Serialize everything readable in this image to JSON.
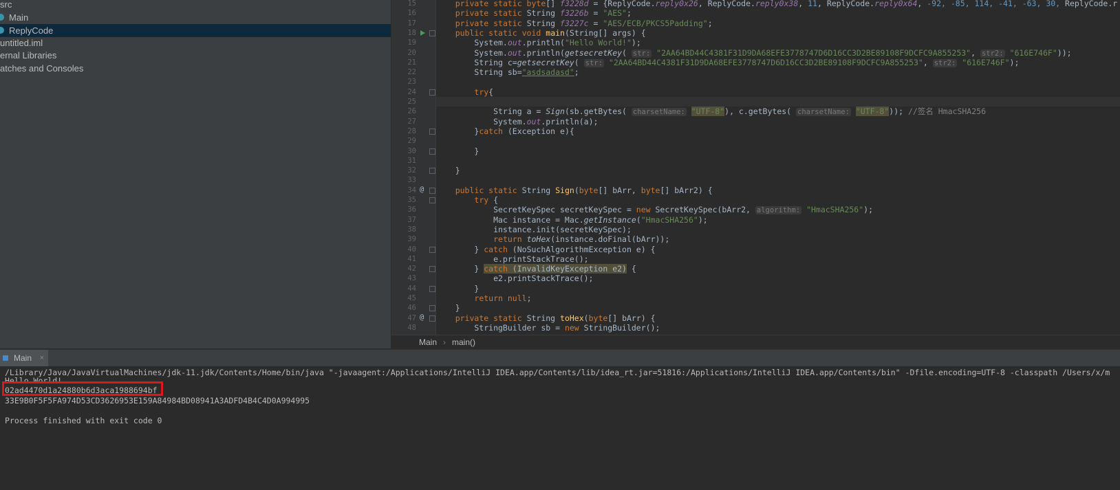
{
  "project_tree": [
    {
      "label": "src",
      "indent": 0,
      "icon": "folder-icon",
      "selected": false
    },
    {
      "label": "Main",
      "indent": 1,
      "icon": "class-icon",
      "selected": false
    },
    {
      "label": "ReplyCode",
      "indent": 1,
      "icon": "class-icon",
      "selected": true
    },
    {
      "label": "untitled.iml",
      "indent": 0,
      "icon": "iml-icon",
      "selected": false
    },
    {
      "label": "ernal Libraries",
      "indent": 0,
      "icon": "library-icon",
      "selected": false
    },
    {
      "label": "atches and Consoles",
      "indent": 0,
      "icon": "scratch-icon",
      "selected": false
    }
  ],
  "line_numbers": [
    "15",
    "16",
    "17",
    "18",
    "19",
    "20",
    "21",
    "22",
    "23",
    "24",
    "25",
    "26",
    "27",
    "28",
    "29",
    "30",
    "31",
    "32",
    "33",
    "34",
    "35",
    "36",
    "37",
    "38",
    "39",
    "40",
    "41",
    "42",
    "43",
    "44",
    "45",
    "46",
    "47",
    "48"
  ],
  "gutter_markers": {
    "run_line": "18",
    "override_lines": [
      "34",
      "47"
    ],
    "override_glyph": "@"
  },
  "code": {
    "l15": {
      "a": "    ",
      "kw": "private static byte",
      "b": "[] ",
      "fld": "f3228d",
      "c": " = {ReplyCode.",
      "r1": "reply0x26",
      "d": ", ReplyCode.",
      "r2": "reply0x38",
      "e": ", ",
      "n1": "11",
      "f": ", ReplyCode.",
      "r3": "reply0x64",
      "g": ", ",
      "n2": "-92, -85, 114, -41, -63, 30,",
      "h": " ReplyCode.r"
    },
    "l16": {
      "a": "    ",
      "kw": "private static ",
      "t": "String ",
      "fld": "f3226b",
      "c": " = ",
      "s": "\"AES\"",
      "d": ";"
    },
    "l17": {
      "a": "    ",
      "kw": "private static ",
      "t": "String ",
      "fld": "f3227c",
      "c": " = ",
      "s": "\"AES/ECB/PKCS5Padding\"",
      "d": ";"
    },
    "l18": {
      "a": "    ",
      "kw": "public static void ",
      "fn": "main",
      "b": "(String[] args) {"
    },
    "l19": {
      "a": "        System.",
      "o": "out",
      "b": ".println(",
      "s": "\"Hello World!\"",
      "c": ");"
    },
    "l20": {
      "a": "        System.",
      "o": "out",
      "b": ".println(",
      "m": "getsecretKey",
      "c": "( ",
      "h1": "str:",
      "s1": "\"2AA64BD44C4381F31D9DA68EFE3778747D6D16CC3D2BE89108F9DCFC9A855253\"",
      "d": ", ",
      "h2": "str2:",
      "s2": "\"616E746F\"",
      "e": "));"
    },
    "l21": {
      "a": "        String c=",
      "m": "getsecretKey",
      "c": "( ",
      "h1": "str:",
      "s1": "\"2AA64BD44C4381F31D9DA68EFE3778747D6D16CC3D2BE89108F9DCFC9A855253\"",
      "d": ", ",
      "h2": "str2:",
      "s2": "\"616E746F\"",
      "e": ");"
    },
    "l22": {
      "a": "        String sb=",
      "s": "\"asdsadasd\"",
      "b": ";"
    },
    "l24": {
      "a": "        ",
      "kw": "try",
      "b": "{"
    },
    "l26": {
      "a": "            String a = ",
      "m": "Sign",
      "b": "(sb.getBytes( ",
      "h1": "charsetName:",
      "s1": "\"UTF-8\"",
      "c": "), c.getBytes( ",
      "h2": "charsetName:",
      "s2": "\"UTF-8\"",
      "d": ")); ",
      "cm": "//签名 HmacSHA256"
    },
    "l27": {
      "a": "            System.",
      "o": "out",
      "b": ".println(a);"
    },
    "l28": {
      "a": "        }",
      "kw": "catch",
      "b": " (Exception e){"
    },
    "l30": {
      "a": "        }"
    },
    "l32": {
      "a": "    }"
    },
    "l34": {
      "a": "    ",
      "kw": "public static ",
      "t": "String ",
      "fn": "Sign",
      "b": "(",
      "k2": "byte",
      "c": "[] bArr, ",
      "k3": "byte",
      "d": "[] bArr2) {"
    },
    "l35": {
      "a": "        ",
      "kw": "try",
      "b": " {"
    },
    "l36": {
      "a": "            SecretKeySpec secretKeySpec = ",
      "kw": "new",
      "b": " SecretKeySpec(bArr2, ",
      "h": "algorithm:",
      "s": "\"HmacSHA256\"",
      "c": ");"
    },
    "l37": {
      "a": "            Mac instance = Mac.",
      "m": "getInstance",
      "b": "(",
      "s": "\"HmacSHA256\"",
      "c": ");"
    },
    "l38": {
      "a": "            instance.init(secretKeySpec);"
    },
    "l39": {
      "a": "            ",
      "kw": "return ",
      "m": "toHex",
      "b": "(instance.doFinal(bArr));"
    },
    "l40": {
      "a": "        } ",
      "kw": "catch",
      "b": " (NoSuchAlgorithmException e) {"
    },
    "l41": {
      "a": "            e.printStackTrace();"
    },
    "l42": {
      "a": "        } ",
      "kw": "catch",
      "b": " (InvalidKeyException e2)",
      "c": " {"
    },
    "l43": {
      "a": "            e2.printStackTrace();"
    },
    "l44": {
      "a": "        }"
    },
    "l45": {
      "a": "        ",
      "kw": "return null",
      "b": ";"
    },
    "l46": {
      "a": "    }"
    },
    "l47": {
      "a": "    ",
      "kw": "private static ",
      "t": "String ",
      "fn": "toHex",
      "b": "(",
      "k2": "byte",
      "c": "[] bArr) {"
    },
    "l48": {
      "a": "        StringBuilder sb = ",
      "kw": "new",
      "b": " StringBuilder();"
    }
  },
  "breadcrumb": {
    "item1": "Main",
    "sep": "›",
    "item2": "main()"
  },
  "run_tab": {
    "label": "Main",
    "close": "×"
  },
  "console": {
    "cmd": "/Library/Java/JavaVirtualMachines/jdk-11.jdk/Contents/Home/bin/java \"-javaagent:/Applications/IntelliJ IDEA.app/Contents/lib/idea_rt.jar=51816:/Applications/IntelliJ IDEA.app/Contents/bin\" -Dfile.encoding=UTF-8 -classpath /Users/x/m",
    "hello": "Hello World!",
    "key": "02ad4470d1a24880b6d3aca1988694bf",
    "sig": "33E9B0F5F5FA974D53CD3626953E159A84984BD08941A3ADFD4B4C4D0A994995",
    "exit": "Process finished with exit code 0"
  },
  "colors": {
    "highlight_box": "#e1161b",
    "keyword": "#cc7832",
    "string": "#6a8759",
    "field": "#9876aa",
    "method": "#ffc66d"
  }
}
